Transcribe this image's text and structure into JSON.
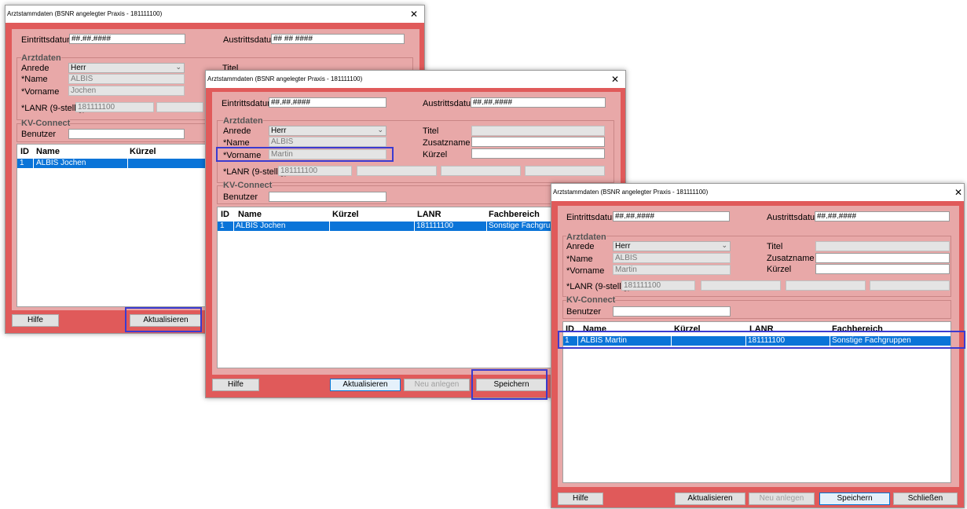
{
  "windows": [
    {
      "title": "Arztstammdaten (BSNR angelegter Praxis - 181111100)",
      "eintritt_label": "Eintrittsdatum",
      "eintritt_value": "##.##.####",
      "austritt_label": "Austrittsdatum",
      "austritt_value": "## ## ####",
      "arztdaten_label": "Arztdaten",
      "anrede_label": "Anrede",
      "anrede_value": "Herr",
      "name_label": "*Name",
      "name_value": "ALBIS",
      "vorname_label": "*Vorname",
      "vorname_value": "Jochen",
      "titel_label": "Titel",
      "lanr_label": "*LANR (9-stellig)",
      "lanr_value": "181111100",
      "kv_label": "KV-Connect",
      "benutzer_label": "Benutzer",
      "col_id": "ID",
      "col_name": "Name",
      "col_kuerzel": "Kürzel",
      "row_id": "1",
      "row_name": "ALBIS Jochen",
      "btn_hilfe": "Hilfe",
      "btn_aktualisieren": "Aktualisieren"
    },
    {
      "title": "Arztstammdaten (BSNR angelegter Praxis - 181111100)",
      "eintritt_label": "Eintrittsdatum",
      "eintritt_value": "##.##.####",
      "austritt_label": "Austrittsdatum",
      "austritt_value": "##.##.####",
      "arztdaten_label": "Arztdaten",
      "anrede_label": "Anrede",
      "anrede_value": "Herr",
      "name_label": "*Name",
      "name_value": "ALBIS",
      "vorname_label": "*Vorname",
      "vorname_value": "Martin",
      "titel_label": "Titel",
      "zusatz_label": "Zusatzname",
      "kuerzel_label": "Kürzel",
      "lanr_label": "*LANR (9-stellig)",
      "lanr_value": "181111100",
      "kv_label": "KV-Connect",
      "benutzer_label": "Benutzer",
      "col_id": "ID",
      "col_name": "Name",
      "col_kuerzel": "Kürzel",
      "col_lanr": "LANR",
      "col_fach": "Fachbereich",
      "row_id": "1",
      "row_name": "ALBIS Jochen",
      "row_lanr": "181111100",
      "row_fach": "Sonstige Fachgrup",
      "btn_hilfe": "Hilfe",
      "btn_aktualisieren": "Aktualisieren",
      "btn_neu": "Neu anlegen",
      "btn_speichern": "Speichern"
    },
    {
      "title": "Arztstammdaten (BSNR angelegter Praxis - 181111100)",
      "eintritt_label": "Eintrittsdatum",
      "eintritt_value": "##.##.####",
      "austritt_label": "Austrittsdatum",
      "austritt_value": "##.##.####",
      "arztdaten_label": "Arztdaten",
      "anrede_label": "Anrede",
      "anrede_value": "Herr",
      "name_label": "*Name",
      "name_value": "ALBIS",
      "vorname_label": "*Vorname",
      "vorname_value": "Martin",
      "titel_label": "Titel",
      "zusatz_label": "Zusatzname",
      "kuerzel_label": "Kürzel",
      "lanr_label": "*LANR (9-stellig)",
      "lanr_value": "181111100",
      "kv_label": "KV-Connect",
      "benutzer_label": "Benutzer",
      "col_id": "ID",
      "col_name": "Name",
      "col_kuerzel": "Kürzel",
      "col_lanr": "LANR",
      "col_fach": "Fachbereich",
      "row_id": "1",
      "row_name": "ALBIS Martin",
      "row_lanr": "181111100",
      "row_fach": "Sonstige Fachgruppen",
      "btn_hilfe": "Hilfe",
      "btn_aktualisieren": "Aktualisieren",
      "btn_neu": "Neu anlegen",
      "btn_speichern": "Speichern",
      "btn_schliessen": "Schließen"
    }
  ],
  "icons": {
    "close": "close-icon",
    "dropdown": "chevron-down-icon"
  },
  "colors": {
    "window_bg": "#e05a5a",
    "panel_bg": "#e8a8a8",
    "selection": "#0a74d8",
    "highlight": "#3b3bd0"
  }
}
